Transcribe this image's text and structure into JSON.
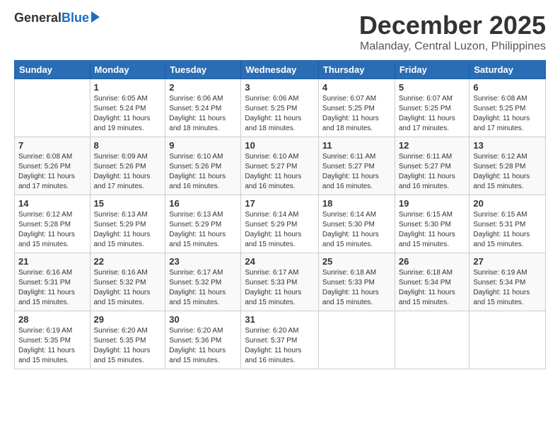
{
  "logo": {
    "general": "General",
    "blue": "Blue"
  },
  "title": "December 2025",
  "location": "Malanday, Central Luzon, Philippines",
  "days_header": [
    "Sunday",
    "Monday",
    "Tuesday",
    "Wednesday",
    "Thursday",
    "Friday",
    "Saturday"
  ],
  "weeks": [
    [
      {
        "day": "",
        "sunrise": "",
        "sunset": "",
        "daylight": ""
      },
      {
        "day": "1",
        "sunrise": "Sunrise: 6:05 AM",
        "sunset": "Sunset: 5:24 PM",
        "daylight": "Daylight: 11 hours and 19 minutes."
      },
      {
        "day": "2",
        "sunrise": "Sunrise: 6:06 AM",
        "sunset": "Sunset: 5:24 PM",
        "daylight": "Daylight: 11 hours and 18 minutes."
      },
      {
        "day": "3",
        "sunrise": "Sunrise: 6:06 AM",
        "sunset": "Sunset: 5:25 PM",
        "daylight": "Daylight: 11 hours and 18 minutes."
      },
      {
        "day": "4",
        "sunrise": "Sunrise: 6:07 AM",
        "sunset": "Sunset: 5:25 PM",
        "daylight": "Daylight: 11 hours and 18 minutes."
      },
      {
        "day": "5",
        "sunrise": "Sunrise: 6:07 AM",
        "sunset": "Sunset: 5:25 PM",
        "daylight": "Daylight: 11 hours and 17 minutes."
      },
      {
        "day": "6",
        "sunrise": "Sunrise: 6:08 AM",
        "sunset": "Sunset: 5:25 PM",
        "daylight": "Daylight: 11 hours and 17 minutes."
      }
    ],
    [
      {
        "day": "7",
        "sunrise": "Sunrise: 6:08 AM",
        "sunset": "Sunset: 5:26 PM",
        "daylight": "Daylight: 11 hours and 17 minutes."
      },
      {
        "day": "8",
        "sunrise": "Sunrise: 6:09 AM",
        "sunset": "Sunset: 5:26 PM",
        "daylight": "Daylight: 11 hours and 17 minutes."
      },
      {
        "day": "9",
        "sunrise": "Sunrise: 6:10 AM",
        "sunset": "Sunset: 5:26 PM",
        "daylight": "Daylight: 11 hours and 16 minutes."
      },
      {
        "day": "10",
        "sunrise": "Sunrise: 6:10 AM",
        "sunset": "Sunset: 5:27 PM",
        "daylight": "Daylight: 11 hours and 16 minutes."
      },
      {
        "day": "11",
        "sunrise": "Sunrise: 6:11 AM",
        "sunset": "Sunset: 5:27 PM",
        "daylight": "Daylight: 11 hours and 16 minutes."
      },
      {
        "day": "12",
        "sunrise": "Sunrise: 6:11 AM",
        "sunset": "Sunset: 5:27 PM",
        "daylight": "Daylight: 11 hours and 16 minutes."
      },
      {
        "day": "13",
        "sunrise": "Sunrise: 6:12 AM",
        "sunset": "Sunset: 5:28 PM",
        "daylight": "Daylight: 11 hours and 15 minutes."
      }
    ],
    [
      {
        "day": "14",
        "sunrise": "Sunrise: 6:12 AM",
        "sunset": "Sunset: 5:28 PM",
        "daylight": "Daylight: 11 hours and 15 minutes."
      },
      {
        "day": "15",
        "sunrise": "Sunrise: 6:13 AM",
        "sunset": "Sunset: 5:29 PM",
        "daylight": "Daylight: 11 hours and 15 minutes."
      },
      {
        "day": "16",
        "sunrise": "Sunrise: 6:13 AM",
        "sunset": "Sunset: 5:29 PM",
        "daylight": "Daylight: 11 hours and 15 minutes."
      },
      {
        "day": "17",
        "sunrise": "Sunrise: 6:14 AM",
        "sunset": "Sunset: 5:29 PM",
        "daylight": "Daylight: 11 hours and 15 minutes."
      },
      {
        "day": "18",
        "sunrise": "Sunrise: 6:14 AM",
        "sunset": "Sunset: 5:30 PM",
        "daylight": "Daylight: 11 hours and 15 minutes."
      },
      {
        "day": "19",
        "sunrise": "Sunrise: 6:15 AM",
        "sunset": "Sunset: 5:30 PM",
        "daylight": "Daylight: 11 hours and 15 minutes."
      },
      {
        "day": "20",
        "sunrise": "Sunrise: 6:15 AM",
        "sunset": "Sunset: 5:31 PM",
        "daylight": "Daylight: 11 hours and 15 minutes."
      }
    ],
    [
      {
        "day": "21",
        "sunrise": "Sunrise: 6:16 AM",
        "sunset": "Sunset: 5:31 PM",
        "daylight": "Daylight: 11 hours and 15 minutes."
      },
      {
        "day": "22",
        "sunrise": "Sunrise: 6:16 AM",
        "sunset": "Sunset: 5:32 PM",
        "daylight": "Daylight: 11 hours and 15 minutes."
      },
      {
        "day": "23",
        "sunrise": "Sunrise: 6:17 AM",
        "sunset": "Sunset: 5:32 PM",
        "daylight": "Daylight: 11 hours and 15 minutes."
      },
      {
        "day": "24",
        "sunrise": "Sunrise: 6:17 AM",
        "sunset": "Sunset: 5:33 PM",
        "daylight": "Daylight: 11 hours and 15 minutes."
      },
      {
        "day": "25",
        "sunrise": "Sunrise: 6:18 AM",
        "sunset": "Sunset: 5:33 PM",
        "daylight": "Daylight: 11 hours and 15 minutes."
      },
      {
        "day": "26",
        "sunrise": "Sunrise: 6:18 AM",
        "sunset": "Sunset: 5:34 PM",
        "daylight": "Daylight: 11 hours and 15 minutes."
      },
      {
        "day": "27",
        "sunrise": "Sunrise: 6:19 AM",
        "sunset": "Sunset: 5:34 PM",
        "daylight": "Daylight: 11 hours and 15 minutes."
      }
    ],
    [
      {
        "day": "28",
        "sunrise": "Sunrise: 6:19 AM",
        "sunset": "Sunset: 5:35 PM",
        "daylight": "Daylight: 11 hours and 15 minutes."
      },
      {
        "day": "29",
        "sunrise": "Sunrise: 6:20 AM",
        "sunset": "Sunset: 5:35 PM",
        "daylight": "Daylight: 11 hours and 15 minutes."
      },
      {
        "day": "30",
        "sunrise": "Sunrise: 6:20 AM",
        "sunset": "Sunset: 5:36 PM",
        "daylight": "Daylight: 11 hours and 15 minutes."
      },
      {
        "day": "31",
        "sunrise": "Sunrise: 6:20 AM",
        "sunset": "Sunset: 5:37 PM",
        "daylight": "Daylight: 11 hours and 16 minutes."
      },
      {
        "day": "",
        "sunrise": "",
        "sunset": "",
        "daylight": ""
      },
      {
        "day": "",
        "sunrise": "",
        "sunset": "",
        "daylight": ""
      },
      {
        "day": "",
        "sunrise": "",
        "sunset": "",
        "daylight": ""
      }
    ]
  ]
}
